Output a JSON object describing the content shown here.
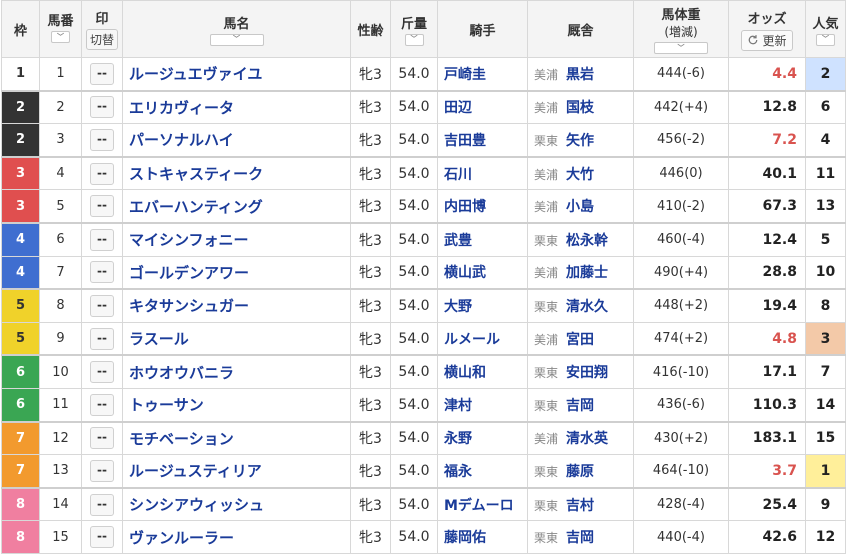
{
  "header": {
    "waku": "枠",
    "umaban": "馬番",
    "mark": "印",
    "mark_toggle": "切替",
    "horse": "馬名",
    "sexage": "性齢",
    "weight": "斤量",
    "jockey": "騎手",
    "stable": "厩舎",
    "body_weight": "馬体重",
    "body_weight_sub": "(増減)",
    "odds": "オッズ",
    "refresh": "更新",
    "popularity": "人気",
    "sort_glyph": "﹀"
  },
  "colors": {
    "waku": {
      "1": {
        "bg": "#ffffff",
        "fg": "#333333"
      },
      "2": {
        "bg": "#333333",
        "fg": "#ffffff"
      },
      "3": {
        "bg": "#e04f4f",
        "fg": "#ffffff"
      },
      "4": {
        "bg": "#3f6ed0",
        "fg": "#ffffff"
      },
      "5": {
        "bg": "#f0d22a",
        "fg": "#333333"
      },
      "6": {
        "bg": "#3aa653",
        "fg": "#ffffff"
      },
      "7": {
        "bg": "#f29a2e",
        "fg": "#ffffff"
      },
      "8": {
        "bg": "#f07fa0",
        "fg": "#ffffff"
      }
    }
  },
  "rows": [
    {
      "waku": "1",
      "num": "1",
      "mark": "--",
      "horse": "ルージュエヴァイユ",
      "sexage": "牝3",
      "weight": "54.0",
      "jockey": "戸崎圭",
      "region": "美浦",
      "trainer": "黒岩",
      "bw": "444(-6)",
      "odds": "4.4",
      "hot": true,
      "pop": "2"
    },
    {
      "waku": "2",
      "num": "2",
      "mark": "--",
      "horse": "エリカヴィータ",
      "sexage": "牝3",
      "weight": "54.0",
      "jockey": "田辺",
      "region": "美浦",
      "trainer": "国枝",
      "bw": "442(+4)",
      "odds": "12.8",
      "hot": false,
      "pop": "6"
    },
    {
      "waku": "2",
      "num": "3",
      "mark": "--",
      "horse": "パーソナルハイ",
      "sexage": "牝3",
      "weight": "54.0",
      "jockey": "吉田豊",
      "region": "栗東",
      "trainer": "矢作",
      "bw": "456(-2)",
      "odds": "7.2",
      "hot": true,
      "pop": "4"
    },
    {
      "waku": "3",
      "num": "4",
      "mark": "--",
      "horse": "ストキャスティーク",
      "sexage": "牝3",
      "weight": "54.0",
      "jockey": "石川",
      "region": "美浦",
      "trainer": "大竹",
      "bw": "446(0)",
      "odds": "40.1",
      "hot": false,
      "pop": "11"
    },
    {
      "waku": "3",
      "num": "5",
      "mark": "--",
      "horse": "エバーハンティング",
      "sexage": "牝3",
      "weight": "54.0",
      "jockey": "内田博",
      "region": "美浦",
      "trainer": "小島",
      "bw": "410(-2)",
      "odds": "67.3",
      "hot": false,
      "pop": "13"
    },
    {
      "waku": "4",
      "num": "6",
      "mark": "--",
      "horse": "マイシンフォニー",
      "sexage": "牝3",
      "weight": "54.0",
      "jockey": "武豊",
      "region": "栗東",
      "trainer": "松永幹",
      "bw": "460(-4)",
      "odds": "12.4",
      "hot": false,
      "pop": "5"
    },
    {
      "waku": "4",
      "num": "7",
      "mark": "--",
      "horse": "ゴールデンアワー",
      "sexage": "牝3",
      "weight": "54.0",
      "jockey": "横山武",
      "region": "美浦",
      "trainer": "加藤士",
      "bw": "490(+4)",
      "odds": "28.8",
      "hot": false,
      "pop": "10"
    },
    {
      "waku": "5",
      "num": "8",
      "mark": "--",
      "horse": "キタサンシュガー",
      "sexage": "牝3",
      "weight": "54.0",
      "jockey": "大野",
      "region": "栗東",
      "trainer": "清水久",
      "bw": "448(+2)",
      "odds": "19.4",
      "hot": false,
      "pop": "8"
    },
    {
      "waku": "5",
      "num": "9",
      "mark": "--",
      "horse": "ラスール",
      "sexage": "牝3",
      "weight": "54.0",
      "jockey": "ルメール",
      "region": "美浦",
      "trainer": "宮田",
      "bw": "474(+2)",
      "odds": "4.8",
      "hot": true,
      "pop": "3"
    },
    {
      "waku": "6",
      "num": "10",
      "mark": "--",
      "horse": "ホウオウバニラ",
      "sexage": "牝3",
      "weight": "54.0",
      "jockey": "横山和",
      "region": "栗東",
      "trainer": "安田翔",
      "bw": "416(-10)",
      "odds": "17.1",
      "hot": false,
      "pop": "7"
    },
    {
      "waku": "6",
      "num": "11",
      "mark": "--",
      "horse": "トゥーサン",
      "sexage": "牝3",
      "weight": "54.0",
      "jockey": "津村",
      "region": "栗東",
      "trainer": "吉岡",
      "bw": "436(-6)",
      "odds": "110.3",
      "hot": false,
      "pop": "14"
    },
    {
      "waku": "7",
      "num": "12",
      "mark": "--",
      "horse": "モチベーション",
      "sexage": "牝3",
      "weight": "54.0",
      "jockey": "永野",
      "region": "美浦",
      "trainer": "清水英",
      "bw": "430(+2)",
      "odds": "183.1",
      "hot": false,
      "pop": "15"
    },
    {
      "waku": "7",
      "num": "13",
      "mark": "--",
      "horse": "ルージュスティリア",
      "sexage": "牝3",
      "weight": "54.0",
      "jockey": "福永",
      "region": "栗東",
      "trainer": "藤原",
      "bw": "464(-10)",
      "odds": "3.7",
      "hot": true,
      "pop": "1"
    },
    {
      "waku": "8",
      "num": "14",
      "mark": "--",
      "horse": "シンシアウィッシュ",
      "sexage": "牝3",
      "weight": "54.0",
      "jockey": "Mデムーロ",
      "region": "栗東",
      "trainer": "吉村",
      "bw": "428(-4)",
      "odds": "25.4",
      "hot": false,
      "pop": "9"
    },
    {
      "waku": "8",
      "num": "15",
      "mark": "--",
      "horse": "ヴァンルーラー",
      "sexage": "牝3",
      "weight": "54.0",
      "jockey": "藤岡佑",
      "region": "栗東",
      "trainer": "吉岡",
      "bw": "440(-4)",
      "odds": "42.6",
      "hot": false,
      "pop": "12"
    }
  ]
}
